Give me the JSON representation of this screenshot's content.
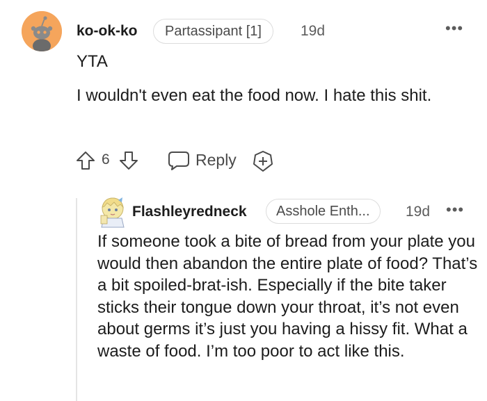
{
  "comment": {
    "username": "ko-ok-ko",
    "flair": "Partassipant [1]",
    "time": "19d",
    "more_label": "•••",
    "verdict": "YTA",
    "body": "I wouldn't even eat the food now. I hate this shit.",
    "vote_count": "6",
    "reply_label": "Reply"
  },
  "reply": {
    "username": "Flashleyredneck",
    "flair": "Asshole Enth...",
    "time": "19d",
    "more_label": "•••",
    "body": "If someone took a bite of bread from your plate you would then abandon the entire plate of food? That’s a bit spoiled-brat-ish. Especially if the bite taker sticks their tongue down your throat, it’s not even about germs it’s just you having a hissy fit. What a waste of food. I’m too poor to act like this."
  },
  "icons": {
    "avatar_main": "snoo-avatar-icon",
    "avatar_reply": "anime-avatar-icon",
    "upvote": "upvote-arrow-icon",
    "downvote": "downvote-arrow-icon",
    "reply": "speech-bubble-icon",
    "award": "award-plus-icon",
    "more": "more-options-icon"
  },
  "colors": {
    "avatar_bg": "#f5a55c",
    "text": "#1c1c1c",
    "muted": "#5c5c5c",
    "border": "#dcdcdc",
    "thread_line": "#e5e5e5"
  }
}
